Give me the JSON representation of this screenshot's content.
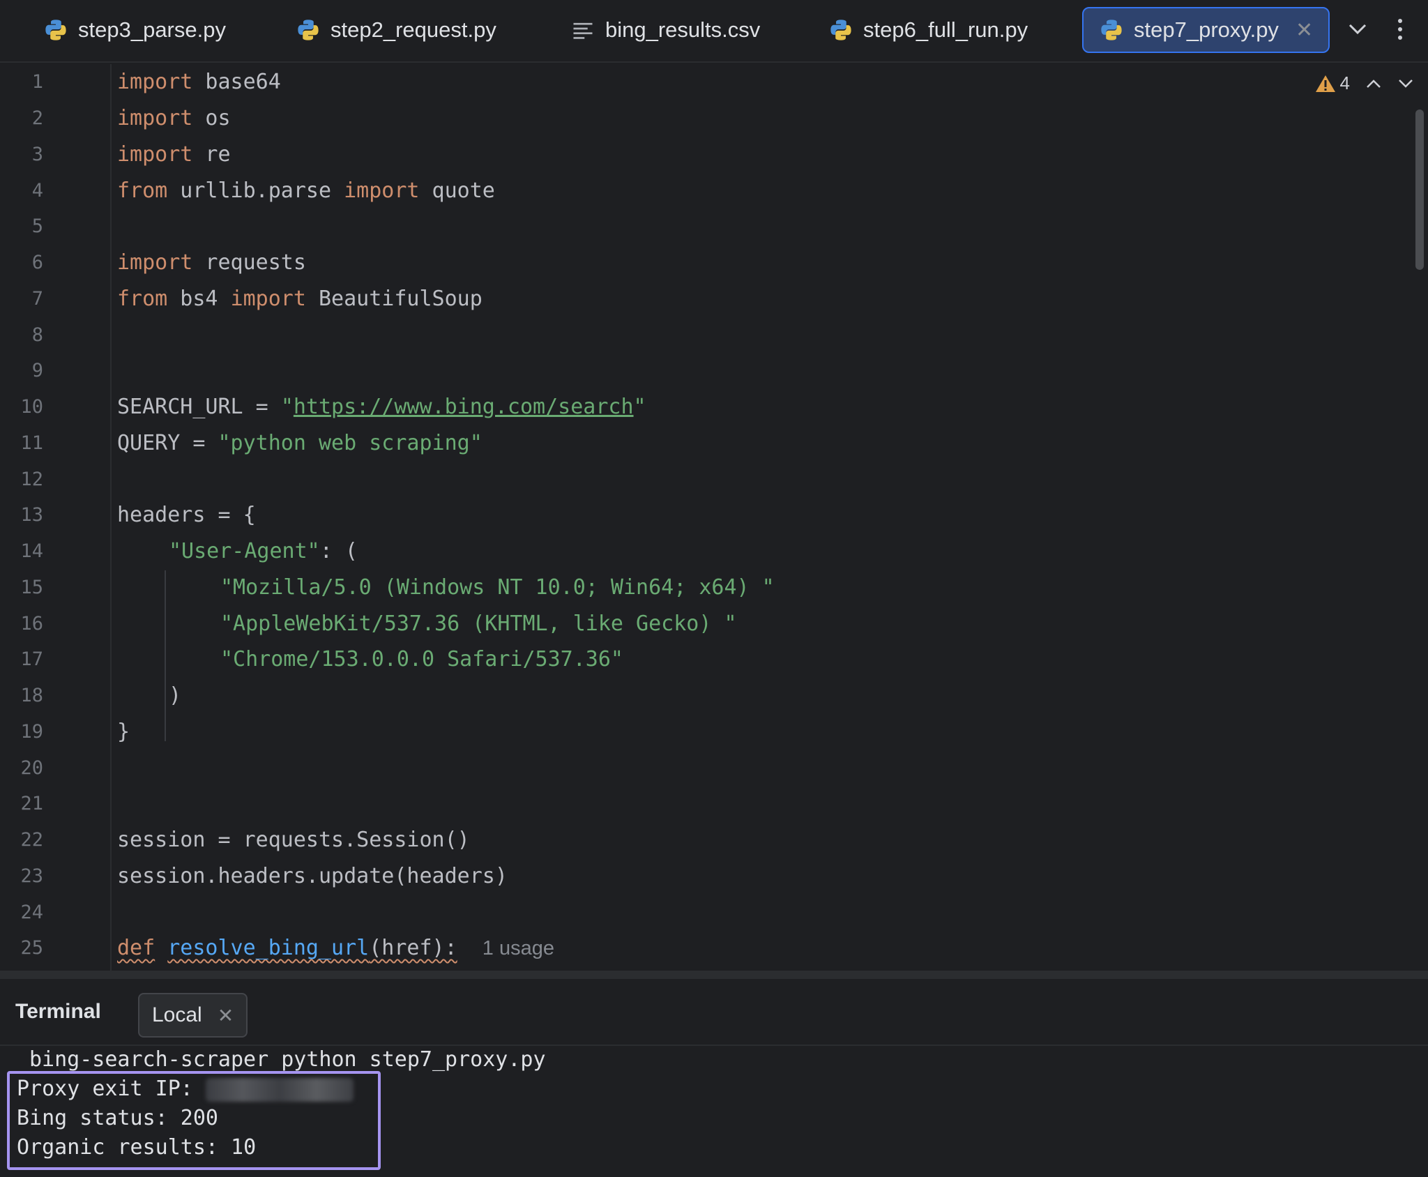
{
  "tabs": [
    {
      "label": "step3_parse.py",
      "icon": "python-icon",
      "active": false
    },
    {
      "label": "step2_request.py",
      "icon": "python-icon",
      "active": false
    },
    {
      "label": "bing_results.csv",
      "icon": "text-file-icon",
      "active": false
    },
    {
      "label": "step6_full_run.py",
      "icon": "python-icon",
      "active": false
    },
    {
      "label": "step7_proxy.py",
      "icon": "python-icon",
      "active": true
    }
  ],
  "inspections": {
    "warning_count": "4"
  },
  "line_numbers": [
    "1",
    "2",
    "3",
    "4",
    "5",
    "6",
    "7",
    "8",
    "9",
    "10",
    "11",
    "12",
    "13",
    "14",
    "15",
    "16",
    "17",
    "18",
    "19",
    "20",
    "21",
    "22",
    "23",
    "24",
    "25"
  ],
  "code": {
    "l1": {
      "kw": "import",
      "rest": " base64"
    },
    "l2": {
      "kw": "import",
      "rest": " os"
    },
    "l3": {
      "kw": "import",
      "rest": " re"
    },
    "l4": {
      "kw1": "from",
      "mid": " urllib.parse ",
      "kw2": "import",
      "rest": " quote"
    },
    "l6": {
      "kw": "import",
      "rest": " requests"
    },
    "l7": {
      "kw1": "from",
      "mid": " bs4 ",
      "kw2": "import",
      "rest": " BeautifulSoup"
    },
    "l10": {
      "pre": "SEARCH_URL = ",
      "q1": "\"",
      "url": "https://www.bing.com/search",
      "q2": "\""
    },
    "l11": {
      "pre": "QUERY = ",
      "str": "\"python web scraping\""
    },
    "l13": "headers = {",
    "l14": {
      "str": "\"User-Agent\"",
      "rest": ": ("
    },
    "l15": "\"Mozilla/5.0 (Windows NT 10.0; Win64; x64) \"",
    "l16": "\"AppleWebKit/537.36 (KHTML, like Gecko) \"",
    "l17": "\"Chrome/153.0.0.0 Safari/537.36\"",
    "l18": ")",
    "l19": "}",
    "l21": "session = requests.Session()",
    "l22": "session.headers.update(headers)",
    "l25": {
      "kw": "def",
      "fn": "resolve_bing_url",
      "rest": "(href):",
      "hint": "1 usage"
    }
  },
  "terminal": {
    "title": "Terminal",
    "tab_label": "Local",
    "command": "bing-search-scraper python step7_proxy.py",
    "output": [
      {
        "label": "Proxy exit IP: ",
        "value_redacted": true
      },
      {
        "label": "Bing status: 200"
      },
      {
        "label": "Organic results: 10"
      }
    ]
  },
  "colors": {
    "background": "#1e1f22",
    "keyword": "#cf8e6d",
    "string": "#6aab73",
    "function": "#56a8f5",
    "active_tab": "#2e436e",
    "highlight_box": "#a594f0"
  }
}
